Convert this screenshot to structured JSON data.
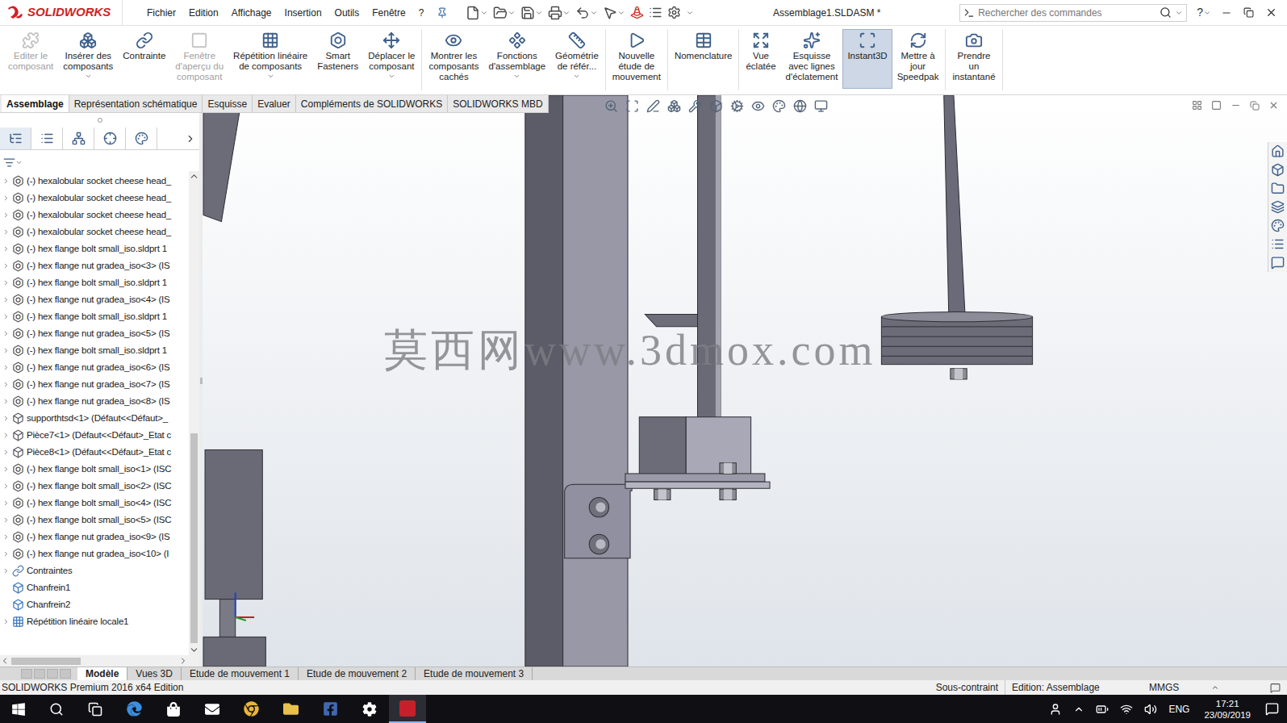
{
  "app": {
    "logo": "SOLIDWORKS",
    "title": "Assemblage1.SLDASM *"
  },
  "menu": [
    "Fichier",
    "Edition",
    "Affichage",
    "Insertion",
    "Outils",
    "Fenêtre",
    "?"
  ],
  "search": {
    "placeholder": "Rechercher des commandes"
  },
  "help": "?",
  "ribbon": [
    [
      {
        "lines": [
          "Editer le",
          "composant"
        ],
        "disabled": true,
        "selected": false,
        "dropdown": false
      },
      {
        "lines": [
          "Insérer des",
          "composants"
        ],
        "disabled": false,
        "selected": false,
        "dropdown": true
      },
      {
        "lines": [
          "Contrainte"
        ],
        "disabled": false,
        "selected": false,
        "dropdown": false
      },
      {
        "lines": [
          "Fenêtre",
          "d'aperçu du",
          "composant"
        ],
        "disabled": true,
        "selected": false,
        "dropdown": false
      },
      {
        "lines": [
          "Répétition linéaire",
          "de composants"
        ],
        "disabled": false,
        "selected": false,
        "dropdown": true
      },
      {
        "lines": [
          "Smart",
          "Fasteners"
        ],
        "disabled": false,
        "selected": false,
        "dropdown": false
      },
      {
        "lines": [
          "Déplacer le",
          "composant"
        ],
        "disabled": false,
        "selected": false,
        "dropdown": true
      }
    ],
    [
      {
        "lines": [
          "Montrer les",
          "composants",
          "cachés"
        ],
        "disabled": false,
        "selected": false,
        "dropdown": false
      },
      {
        "lines": [
          "Fonctions",
          "d'assemblage"
        ],
        "disabled": false,
        "selected": false,
        "dropdown": true
      },
      {
        "lines": [
          "Géométrie",
          "de référ..."
        ],
        "disabled": false,
        "selected": false,
        "dropdown": true
      }
    ],
    [
      {
        "lines": [
          "Nouvelle",
          "étude de",
          "mouvement"
        ],
        "disabled": false,
        "selected": false,
        "dropdown": false
      }
    ],
    [
      {
        "lines": [
          "Nomenclature"
        ],
        "disabled": false,
        "selected": false,
        "dropdown": false
      }
    ],
    [
      {
        "lines": [
          "Vue",
          "éclatée"
        ],
        "disabled": false,
        "selected": false,
        "dropdown": false
      },
      {
        "lines": [
          "Esquisse",
          "avec lignes",
          "d'éclatement"
        ],
        "disabled": false,
        "selected": false,
        "dropdown": false
      },
      {
        "lines": [
          "Instant3D"
        ],
        "disabled": false,
        "selected": true,
        "dropdown": false
      },
      {
        "lines": [
          "Mettre à",
          "jour",
          "Speedpak"
        ],
        "disabled": false,
        "selected": false,
        "dropdown": false
      }
    ],
    [
      {
        "lines": [
          "Prendre",
          "un",
          "instantané"
        ],
        "disabled": false,
        "selected": false,
        "dropdown": false
      }
    ]
  ],
  "ribbon_tabs": [
    {
      "label": "Assemblage",
      "selected": true
    },
    {
      "label": "Représentation schématique",
      "selected": false
    },
    {
      "label": "Esquisse",
      "selected": false
    },
    {
      "label": "Evaluer",
      "selected": false
    },
    {
      "label": "Compléments de SOLIDWORKS",
      "selected": false
    },
    {
      "label": "SOLIDWORKS MBD",
      "selected": false
    }
  ],
  "tree": {
    "items": [
      {
        "label": "(-) hexalobular socket cheese head_",
        "kind": "fastener",
        "expandable": true
      },
      {
        "label": "(-) hexalobular socket cheese head_",
        "kind": "fastener",
        "expandable": true
      },
      {
        "label": "(-) hexalobular socket cheese head_",
        "kind": "fastener",
        "expandable": true
      },
      {
        "label": "(-) hexalobular socket cheese head_",
        "kind": "fastener",
        "expandable": true
      },
      {
        "label": "(-) hex flange bolt small_iso.sldprt 1",
        "kind": "fastener",
        "expandable": true
      },
      {
        "label": "(-) hex flange nut gradea_iso<3> (IS",
        "kind": "fastener",
        "expandable": true
      },
      {
        "label": "(-) hex flange bolt small_iso.sldprt 1",
        "kind": "fastener",
        "expandable": true
      },
      {
        "label": "(-) hex flange nut gradea_iso<4> (IS",
        "kind": "fastener",
        "expandable": true
      },
      {
        "label": "(-) hex flange bolt small_iso.sldprt 1",
        "kind": "fastener",
        "expandable": true
      },
      {
        "label": "(-) hex flange nut gradea_iso<5> (IS",
        "kind": "fastener",
        "expandable": true
      },
      {
        "label": "(-) hex flange bolt small_iso.sldprt 1",
        "kind": "fastener",
        "expandable": true
      },
      {
        "label": "(-) hex flange nut gradea_iso<6> (IS",
        "kind": "fastener",
        "expandable": true
      },
      {
        "label": "(-) hex flange nut gradea_iso<7> (IS",
        "kind": "fastener",
        "expandable": true
      },
      {
        "label": "(-) hex flange nut gradea_iso<8> (IS",
        "kind": "fastener",
        "expandable": true
      },
      {
        "label": "supporthtsd<1> (Défaut<<Défaut>_",
        "kind": "part",
        "expandable": true
      },
      {
        "label": "Pièce7<1> (Défaut<<Défaut>_Etat c",
        "kind": "part",
        "expandable": true
      },
      {
        "label": "Pièce8<1> (Défaut<<Défaut>_Etat c",
        "kind": "part",
        "expandable": true
      },
      {
        "label": "(-) hex flange bolt small_iso<1> (ISC",
        "kind": "fastener",
        "expandable": true
      },
      {
        "label": "(-) hex flange bolt small_iso<2> (ISC",
        "kind": "fastener",
        "expandable": true
      },
      {
        "label": "(-) hex flange bolt small_iso<4> (ISC",
        "kind": "fastener",
        "expandable": true
      },
      {
        "label": "(-) hex flange bolt small_iso<5> (ISC",
        "kind": "fastener",
        "expandable": true
      },
      {
        "label": "(-) hex flange nut gradea_iso<9> (IS",
        "kind": "fastener",
        "expandable": true
      },
      {
        "label": "(-) hex flange nut gradea_iso<10> (I",
        "kind": "fastener",
        "expandable": true
      },
      {
        "label": "Contraintes",
        "kind": "folder",
        "expandable": true
      },
      {
        "label": "Chanfrein1",
        "kind": "feature",
        "expandable": false
      },
      {
        "label": "Chanfrein2",
        "kind": "feature",
        "expandable": false
      },
      {
        "label": "Répétition linéaire locale1",
        "kind": "pattern",
        "expandable": true
      }
    ]
  },
  "viewport": {
    "watermark": "莫西网www.3dmox.com"
  },
  "bottom_tabs": [
    {
      "label": "Modèle",
      "selected": true
    },
    {
      "label": "Vues 3D",
      "selected": false
    },
    {
      "label": "Etude de mouvement 1",
      "selected": false
    },
    {
      "label": "Etude de mouvement 2",
      "selected": false
    },
    {
      "label": "Etude de mouvement 3",
      "selected": false
    }
  ],
  "status_bar": {
    "product": "SOLIDWORKS Premium 2016 x64 Edition",
    "state": "Sous-contraint",
    "mode": "Edition: Assemblage",
    "units": "MMGS"
  },
  "taskbar": {
    "language": "ENG",
    "time": "17:21",
    "date": "23/09/2019"
  }
}
